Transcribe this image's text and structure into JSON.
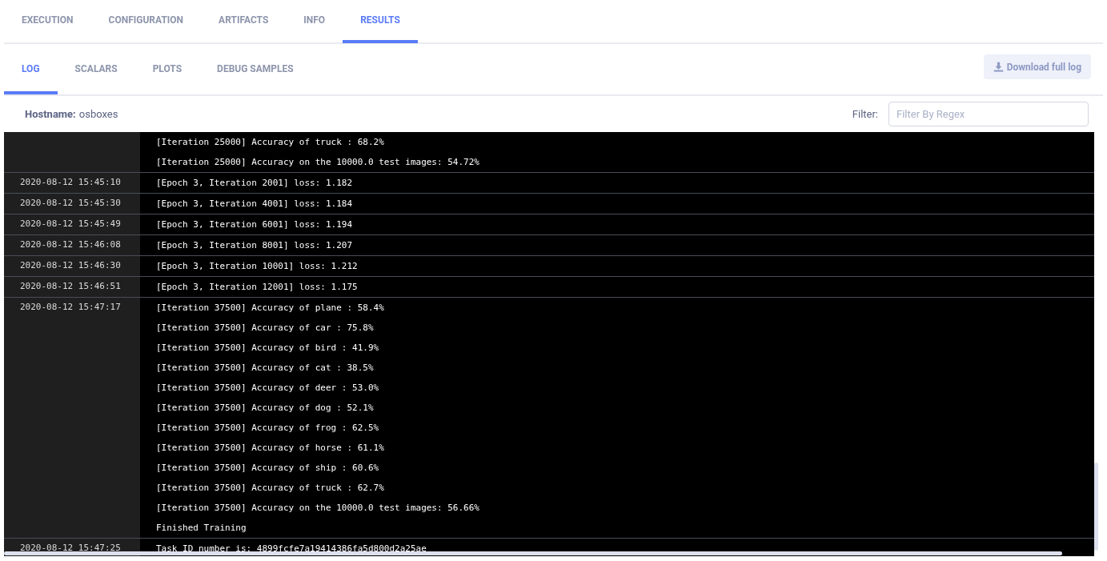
{
  "tabs": [
    {
      "label": "EXECUTION",
      "selected": false
    },
    {
      "label": "CONFIGURATION",
      "selected": false
    },
    {
      "label": "ARTIFACTS",
      "selected": false
    },
    {
      "label": "INFO",
      "selected": false
    },
    {
      "label": "RESULTS",
      "selected": true
    }
  ],
  "subtabs": [
    {
      "label": "LOG",
      "selected": true
    },
    {
      "label": "SCALARS",
      "selected": false
    },
    {
      "label": "PLOTS",
      "selected": false
    },
    {
      "label": "DEBUG SAMPLES",
      "selected": false
    }
  ],
  "download_button": "Download full log",
  "hostname": {
    "label": "Hostname:",
    "value": "osboxes"
  },
  "filter": {
    "label": "Filter:",
    "placeholder": "Filter By Regex"
  },
  "log": [
    {
      "lines": [
        "[Iteration 25000] Accuracy of truck : 68.2%",
        "[Iteration 25000] Accuracy on the 10000.0 test images: 54.72%"
      ]
    },
    {
      "time": "2020-08-12 15:45:10",
      "lines": [
        "[Epoch 3, Iteration 2001] loss: 1.182"
      ]
    },
    {
      "time": "2020-08-12 15:45:30",
      "lines": [
        "[Epoch 3, Iteration 4001] loss: 1.184"
      ]
    },
    {
      "time": "2020-08-12 15:45:49",
      "lines": [
        "[Epoch 3, Iteration 6001] loss: 1.194"
      ]
    },
    {
      "time": "2020-08-12 15:46:08",
      "lines": [
        "[Epoch 3, Iteration 8001] loss: 1.207"
      ]
    },
    {
      "time": "2020-08-12 15:46:30",
      "lines": [
        "[Epoch 3, Iteration 10001] loss: 1.212"
      ]
    },
    {
      "time": "2020-08-12 15:46:51",
      "lines": [
        "[Epoch 3, Iteration 12001] loss: 1.175"
      ]
    },
    {
      "time": "2020-08-12 15:47:17",
      "lines": [
        "[Iteration 37500] Accuracy of plane : 58.4%",
        "[Iteration 37500] Accuracy of car : 75.8%",
        "[Iteration 37500] Accuracy of bird : 41.9%",
        "[Iteration 37500] Accuracy of cat : 38.5%",
        "[Iteration 37500] Accuracy of deer : 53.0%",
        "[Iteration 37500] Accuracy of dog : 52.1%",
        "[Iteration 37500] Accuracy of frog : 62.5%",
        "[Iteration 37500] Accuracy of horse : 61.1%",
        "[Iteration 37500] Accuracy of ship : 60.6%",
        "[Iteration 37500] Accuracy of truck : 62.7%",
        "[Iteration 37500] Accuracy on the 10000.0 test images: 56.66%",
        "Finished Training"
      ]
    },
    {
      "time": "2020-08-12 15:47:25",
      "lines": [
        "Task ID number is: 4899fcfe7a19414386fa5d800d2a25ae"
      ]
    }
  ]
}
